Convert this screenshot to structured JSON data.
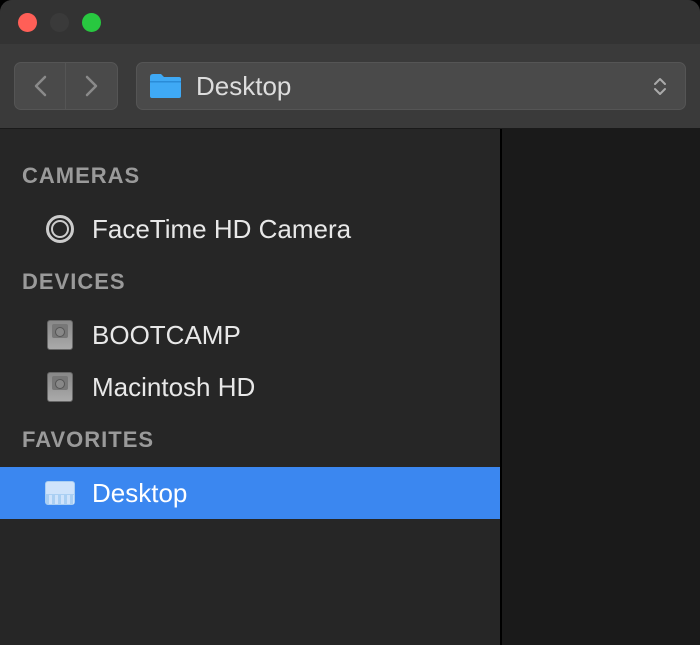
{
  "window": {
    "traffic": {
      "close_color": "#ff5f57",
      "min_color": "#3a3a3a",
      "max_color": "#28c840"
    }
  },
  "toolbar": {
    "location_label": "Desktop",
    "folder_color": "#3fa9f5"
  },
  "sidebar": {
    "sections": [
      {
        "header": "CAMERAS",
        "items": [
          {
            "label": "FaceTime HD Camera",
            "icon": "camera"
          }
        ]
      },
      {
        "header": "DEVICES",
        "items": [
          {
            "label": "BOOTCAMP",
            "icon": "disk"
          },
          {
            "label": "Macintosh HD",
            "icon": "disk"
          }
        ]
      },
      {
        "header": "FAVORITES",
        "items": [
          {
            "label": "Desktop",
            "icon": "desktop",
            "selected": true
          }
        ]
      }
    ]
  }
}
